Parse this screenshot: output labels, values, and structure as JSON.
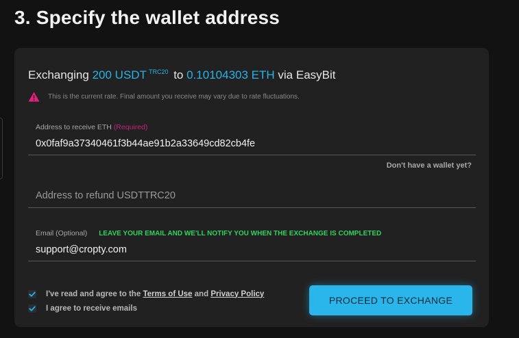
{
  "step_title": "3. Specify the wallet address",
  "summary": {
    "prefix": "Exchanging",
    "from_amount": "200 USDT",
    "from_network": "TRC20",
    "to_word": "to",
    "to_amount": "0.10104303 ETH",
    "via": "via EasyBit"
  },
  "rate_note": "This is the current rate. Final amount you receive may vary due to rate fluctuations.",
  "receive_address": {
    "label": "Address to receive ETH",
    "required": "(Required)",
    "value": "0x0faf9a37340461f3b44ae91b2a33649cd82cb4fe"
  },
  "no_wallet_link": "Don't have a wallet yet?",
  "refund_address": {
    "placeholder": "Address to refund USDTTRC20"
  },
  "email": {
    "label": "Email (Optional)",
    "hint": "LEAVE YOUR EMAIL AND WE'LL NOTIFY YOU WHEN THE EXCHANGE IS COMPLETED",
    "value": "support@cropty.com"
  },
  "agreement": {
    "prefix": "I've read and agree to the",
    "terms": "Terms of Use",
    "and": "and",
    "privacy": "Privacy Policy",
    "checked": true
  },
  "emails_consent": {
    "label": "I agree to receive emails",
    "checked": true
  },
  "proceed_label": "PROCEED TO EXCHANGE",
  "colors": {
    "accent": "#27b3e8",
    "required": "#c2277a",
    "hint": "#2fd35e",
    "warning": "#e0227a"
  }
}
